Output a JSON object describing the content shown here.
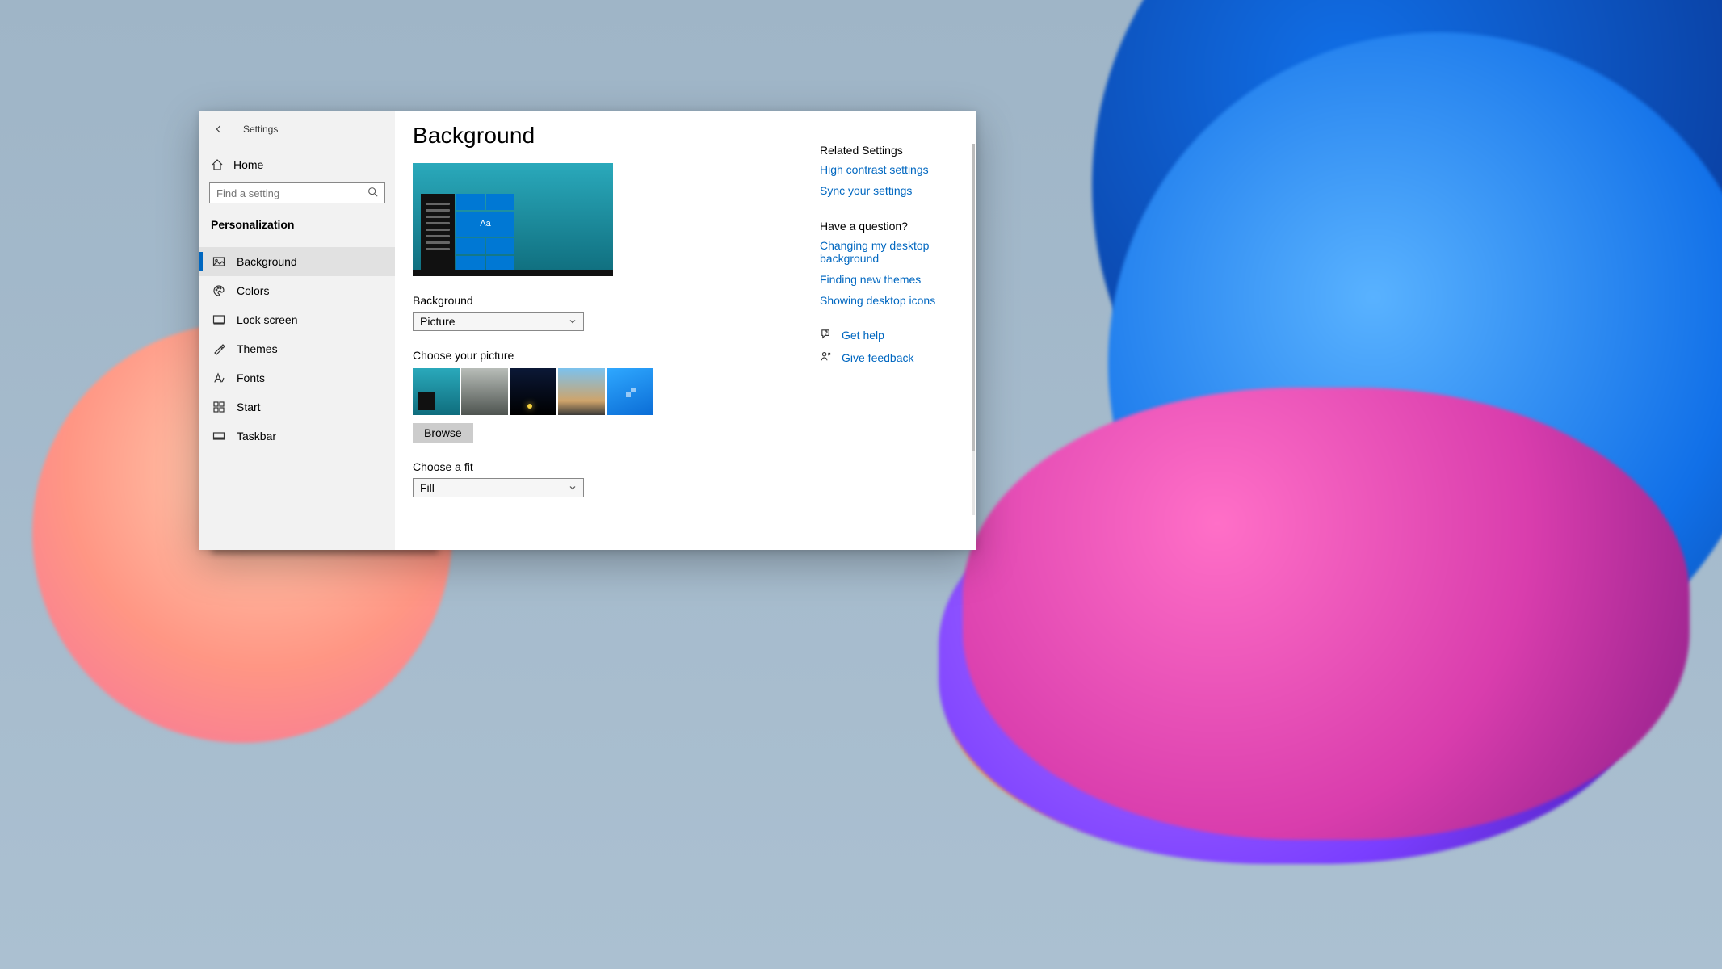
{
  "window": {
    "app_title": "Settings",
    "page_title": "Background"
  },
  "nav": {
    "home_label": "Home",
    "search_placeholder": "Find a setting",
    "category_label": "Personalization",
    "items": [
      {
        "label": "Background",
        "selected": true
      },
      {
        "label": "Colors",
        "selected": false
      },
      {
        "label": "Lock screen",
        "selected": false
      },
      {
        "label": "Themes",
        "selected": false
      },
      {
        "label": "Fonts",
        "selected": false
      },
      {
        "label": "Start",
        "selected": false
      },
      {
        "label": "Taskbar",
        "selected": false
      }
    ]
  },
  "content": {
    "preview_sample_text": "Aa",
    "background_label": "Background",
    "background_value": "Picture",
    "choose_picture_label": "Choose your picture",
    "browse_label": "Browse",
    "choose_fit_label": "Choose a fit",
    "fit_value": "Fill"
  },
  "rside": {
    "related_header": "Related Settings",
    "related_links": [
      "High contrast settings",
      "Sync your settings"
    ],
    "question_header": "Have a question?",
    "question_links": [
      "Changing my desktop background",
      "Finding new themes",
      "Showing desktop icons"
    ],
    "help_label": "Get help",
    "feedback_label": "Give feedback"
  }
}
